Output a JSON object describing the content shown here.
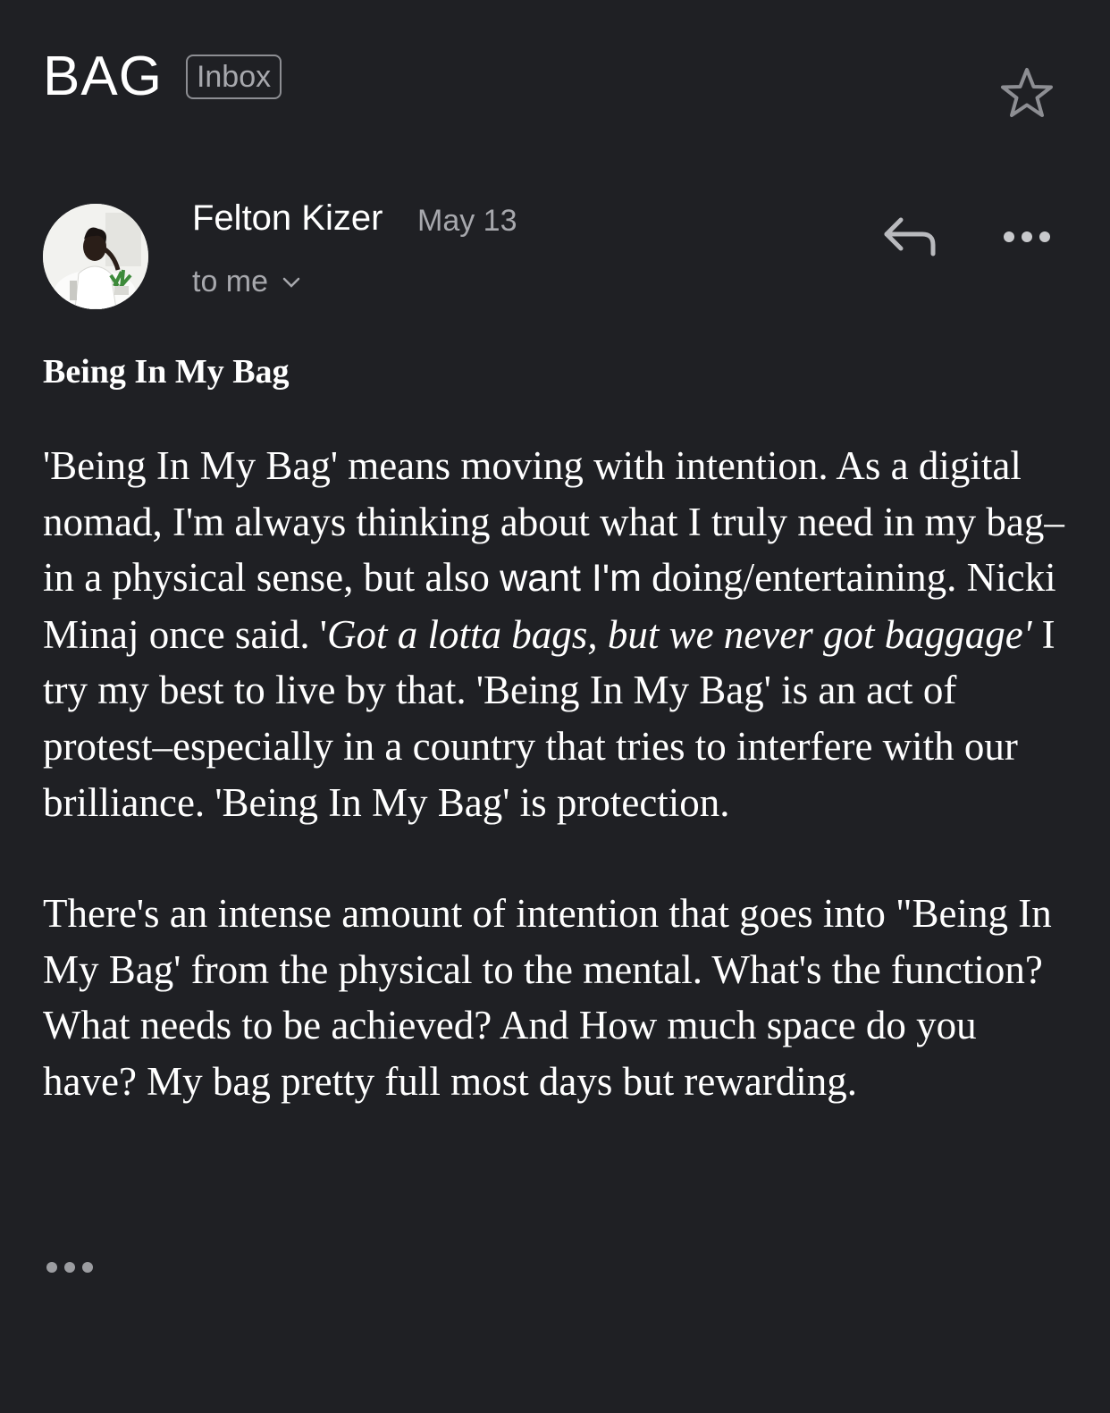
{
  "email": {
    "subject": "BAG",
    "label": "Inbox",
    "sender": "Felton Kizer",
    "date": "May 13",
    "recipient": "to me",
    "heading": "Being In My Bag",
    "p1": {
      "a": "'Being In My Bag' means moving with intention. As a digital nomad, I'm always thinking about what I truly need in my bag–in a physical sense, but also ",
      "b": "want I'm",
      "c": " doing/entertaining. Nicki Minaj once said. '",
      "d": "Got a lotta bags, but we never got baggage'",
      "e": " I try my best to live by that. 'Being In My Bag' is an act of protest–especially in a country that tries to interfere with our brilliance. 'Being In My Bag' is protection."
    },
    "p2": "There's an intense amount of intention that goes into \"Being In My Bag' from the physical to the mental. What's the function? What needs to be achieved? And How much space do you have? My bag pretty full most days but rewarding."
  },
  "icons": {
    "star": "star-outline-icon",
    "reply": "reply-icon",
    "more": "more-horizontal-icon",
    "expand": "chevron-down-icon",
    "trimmed": "ellipsis-icon"
  },
  "colors": {
    "background": "#1f2024",
    "text": "#ffffff",
    "muted": "#a7a8ad"
  }
}
